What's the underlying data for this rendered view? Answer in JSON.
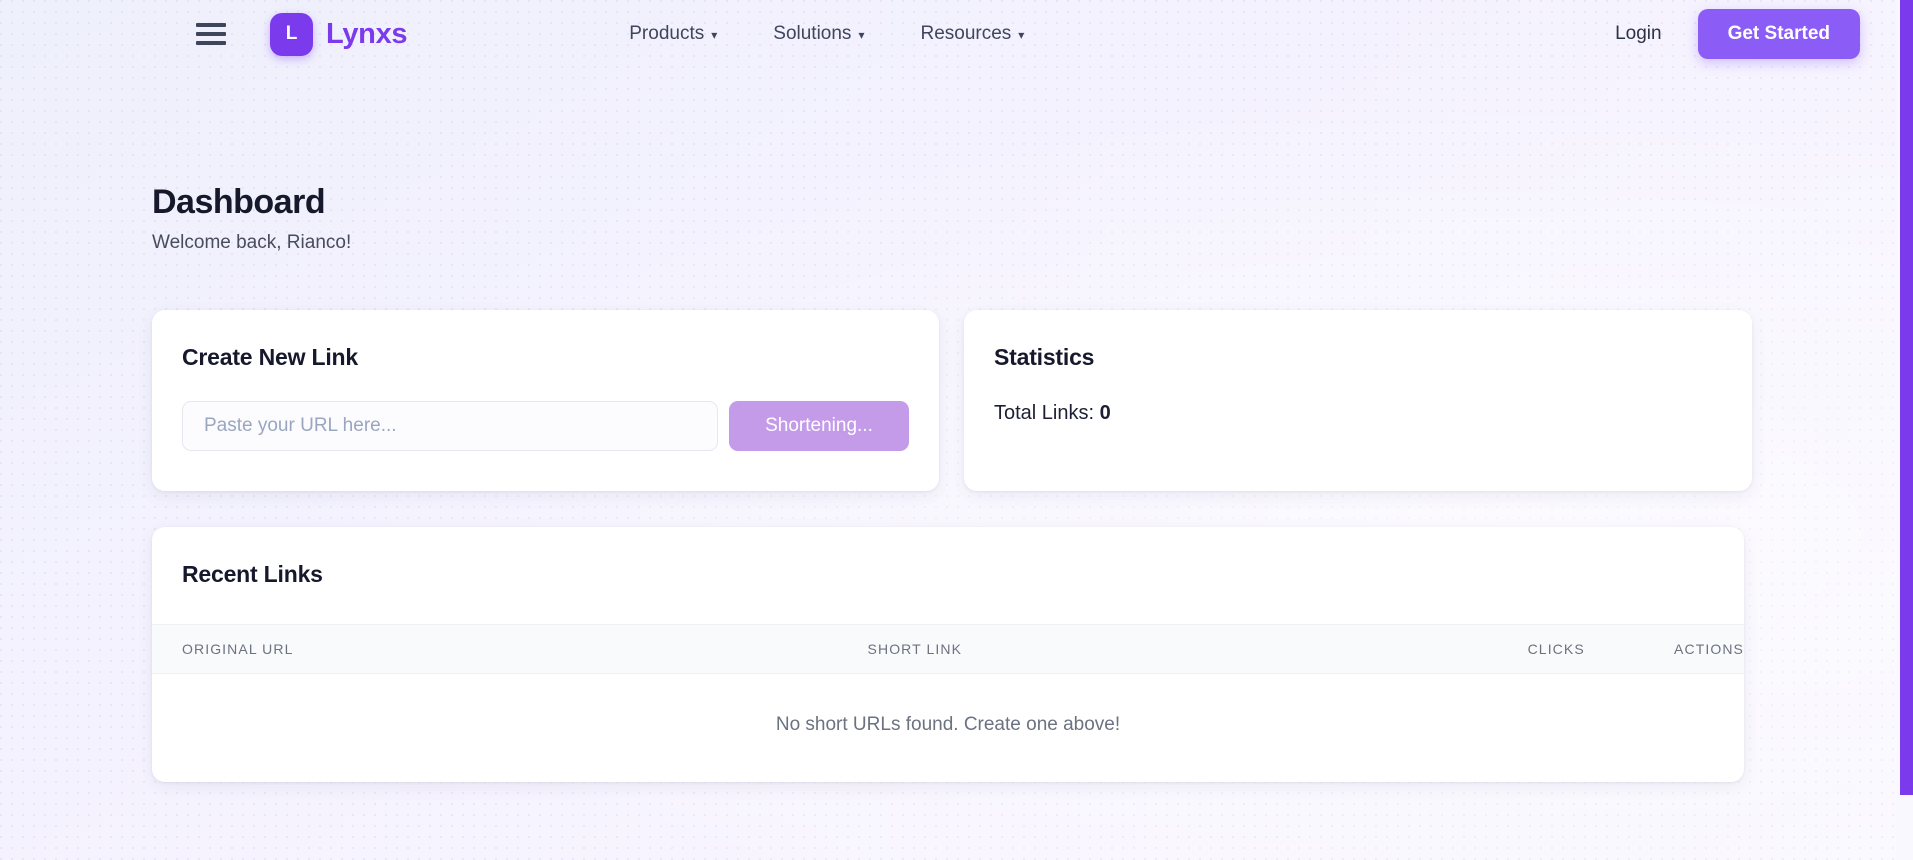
{
  "navbar": {
    "menu_icon": "hamburger-icon",
    "brand": {
      "badge_letter": "L",
      "name": "Lynxs"
    },
    "links": [
      {
        "label": "Products",
        "caret": "▾"
      },
      {
        "label": "Solutions",
        "caret": "▾"
      },
      {
        "label": "Resources",
        "caret": "▾"
      }
    ],
    "login_label": "Login",
    "cta_label": "Get Started"
  },
  "header": {
    "title": "Dashboard",
    "subtitle": "Welcome back, Rianco!"
  },
  "create_card": {
    "title": "Create New Link",
    "input_placeholder": "Paste your URL here...",
    "input_value": "",
    "button_label": "Shortening..."
  },
  "stats_card": {
    "title": "Statistics",
    "total_links_label": "Total Links:",
    "total_links_value": "0"
  },
  "recent_card": {
    "title": "Recent Links",
    "columns": [
      "ORIGINAL URL",
      "SHORT LINK",
      "CLICKS",
      "ACTIONS"
    ],
    "empty_message": "No short URLs found. Create one above!",
    "rows": []
  },
  "colors": {
    "brand_purple": "#7c3aed",
    "cta_purple": "#8b5cf6",
    "button_disabled_purple": "#c49be8",
    "page_background": "#f5f3ff",
    "text_dark": "#16182b",
    "text_muted": "#6b7280",
    "table_header_bg": "#f9fafb",
    "scrollbar_thumb": "#7c3aed"
  }
}
